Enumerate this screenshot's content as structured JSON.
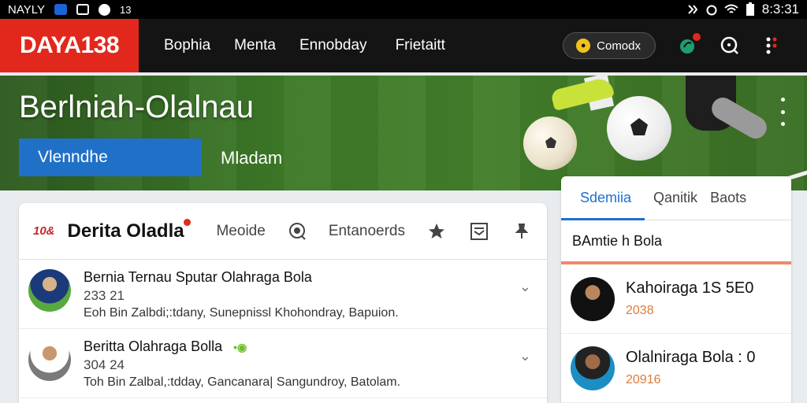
{
  "status_bar": {
    "left_text": "NAYLY",
    "left_icon_label": "13",
    "time": "8:3:31",
    "right_icons": [
      "nfc-icon",
      "alarm-icon",
      "wifi-icon",
      "battery-icon"
    ]
  },
  "app_bar": {
    "logo": "DAYA138",
    "nav": [
      "Bophia",
      "Menta",
      "Ennobday",
      "Frietaitt"
    ],
    "coin_button_label": "Comodx"
  },
  "hero": {
    "title": "Berlniah-Olalnau",
    "primary_button": "Vlenndhe",
    "secondary_link": "Mladam"
  },
  "main_card": {
    "brand_mark": "10&",
    "title": "Derita Oladla",
    "tools": {
      "text1": "Meoide",
      "text2": "Entanoerds"
    },
    "feed": [
      {
        "title": "Bernia Ternau Sputar Olahraga Bola",
        "number": "233 21",
        "subtitle": "Eoh Bin Zalbdi;:tdany, Sunepnissl Khohondray, Bapuion."
      },
      {
        "title": "Beritta Olahraga Bolla",
        "number": "304 24",
        "subtitle": "Toh Bin Zalbal,:tdday, Gancanara| Sangundroy, Batolam."
      }
    ]
  },
  "side_panel": {
    "tabs": [
      "Sdemiia",
      "Qanitik",
      "Baots"
    ],
    "section_title": "BAmtie h Bola",
    "items": [
      {
        "title": "Kahoiraga 1S 5E0",
        "year": "2038"
      },
      {
        "title": "Olalniraga Bola : 0",
        "year": "20916"
      }
    ]
  },
  "colors": {
    "logo_bg": "#e2281c",
    "accent_blue": "#2170c8",
    "tab_blue": "#1f6fd0",
    "section_accent": "#ef8a6a",
    "year_orange": "#e07a3a"
  }
}
